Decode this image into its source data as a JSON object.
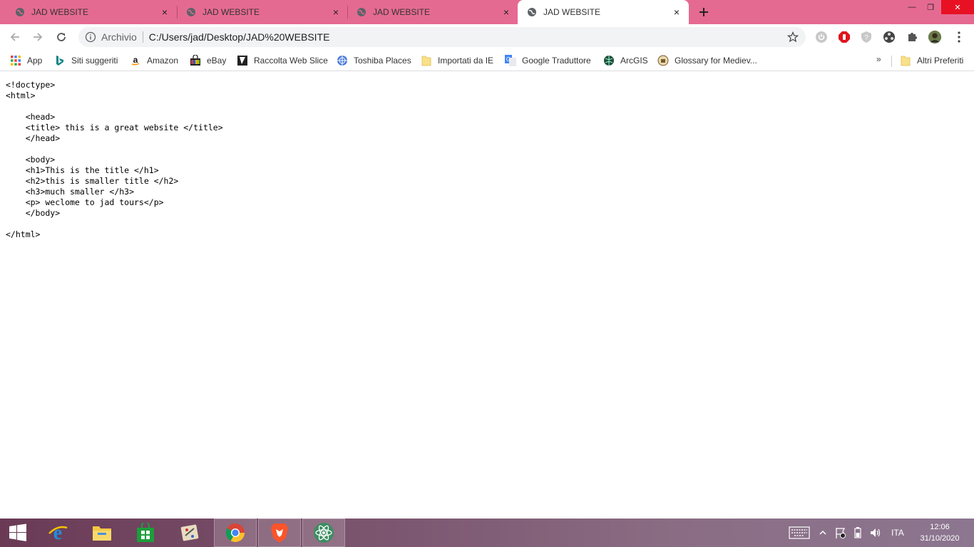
{
  "browser": {
    "tabs": [
      {
        "title": "JAD WEBSITE",
        "active": false
      },
      {
        "title": "JAD WEBSITE",
        "active": false
      },
      {
        "title": "JAD WEBSITE",
        "active": false
      },
      {
        "title": "JAD WEBSITE",
        "active": true
      }
    ],
    "tab_close_glyph": "×",
    "new_tab_glyph": "+",
    "window_controls": {
      "minimize": "—",
      "restore": "❐",
      "close": "✕"
    },
    "omnibox": {
      "scheme_label": "Archivio",
      "url": "C:/Users/jad/Desktop/JAD%20WEBSITE"
    },
    "accent_color": "#e56a92"
  },
  "bookmarks": {
    "items": [
      {
        "label": "App",
        "icon": "apps-grid-icon"
      },
      {
        "label": "Siti suggeriti",
        "icon": "bing-icon"
      },
      {
        "label": "Amazon",
        "icon": "amazon-icon"
      },
      {
        "label": "eBay",
        "icon": "ebay-bag-icon"
      },
      {
        "label": "Raccolta Web Slice",
        "icon": "web-slice-icon"
      },
      {
        "label": "Toshiba Places",
        "icon": "toshiba-icon"
      },
      {
        "label": "Importati da IE",
        "icon": "folder-icon"
      },
      {
        "label": "Google Traduttore",
        "icon": "google-translate-icon"
      },
      {
        "label": "ArcGIS",
        "icon": "arcgis-globe-icon"
      },
      {
        "label": "Glossary for Mediev...",
        "icon": "glossary-icon"
      }
    ],
    "overflow": "»",
    "other_bookmarks": "Altri Preferiti"
  },
  "page": {
    "source_lines": [
      "<!doctype>",
      "<html>",
      "",
      "    <head>",
      "    <title> this is a great website </title>",
      "    </head>",
      "",
      "    <body>",
      "    <h1>This is the title </h1>",
      "    <h2>this is smaller title </h2>",
      "    <h3>much smaller </h3>",
      "    <p> weclome to jad tours</p>",
      "    </body>",
      "",
      "</html>"
    ]
  },
  "taskbar": {
    "apps": [
      {
        "name": "windows-start",
        "open": false
      },
      {
        "name": "internet-explorer",
        "open": false
      },
      {
        "name": "file-explorer",
        "open": false
      },
      {
        "name": "windows-store",
        "open": false
      },
      {
        "name": "paint-app",
        "open": false
      },
      {
        "name": "chrome",
        "open": true
      },
      {
        "name": "brave",
        "open": true
      },
      {
        "name": "atom-editor",
        "open": true
      }
    ],
    "language": "ITA",
    "time": "12:06",
    "date": "31/10/2020"
  }
}
